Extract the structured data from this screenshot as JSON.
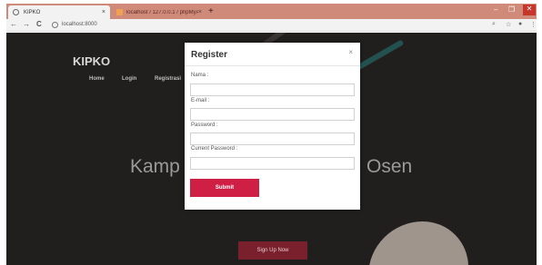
{
  "browser": {
    "active_tab_title": "KIPKO",
    "inactive_tab_title": "localhost / 127.0.0.1 / phpMyAdmin",
    "new_tab_glyph": "+",
    "close_glyph": "×",
    "minimize_glyph": "–",
    "maximize_glyph": "❐",
    "window_close_glyph": "✕",
    "back_glyph": "←",
    "forward_glyph": "→",
    "reload_glyph": "C",
    "url": "localhost:8000",
    "zoom_glyph": "⌕",
    "star_glyph": "☆",
    "account_glyph": "●",
    "menu_glyph": "⋮"
  },
  "site": {
    "brand": "KIPKO",
    "nav": [
      "Home",
      "Login",
      "Registrasi"
    ],
    "hero_left": "Kamp",
    "hero_right": "Osen",
    "signup_label": "Sign Up Now"
  },
  "modal": {
    "title": "Register",
    "close": "×",
    "fields": [
      {
        "label": "Nama :",
        "value": ""
      },
      {
        "label": "E-mail :",
        "value": ""
      },
      {
        "label": "Password :",
        "value": ""
      },
      {
        "label": "Current Password :",
        "value": ""
      }
    ],
    "submit_label": "Submit"
  },
  "colors": {
    "tab_bar": "#d08a7a",
    "page_background": "#2c2a28",
    "submit_button": "#d01f45",
    "signup_button": "#7a1f2c"
  }
}
